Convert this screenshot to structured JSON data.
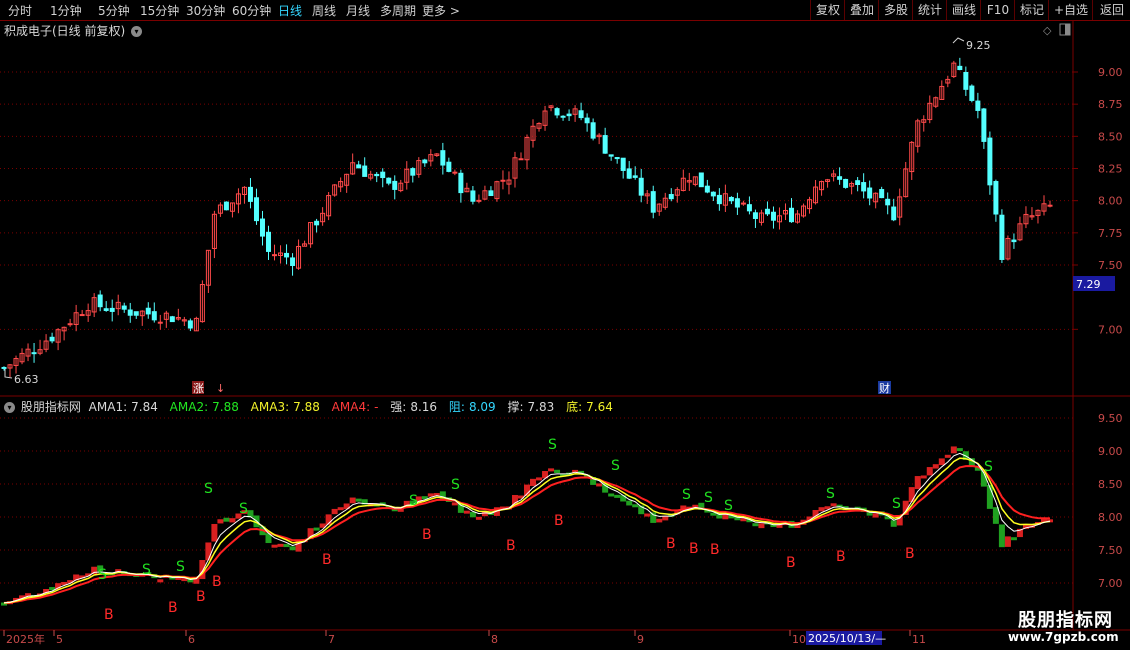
{
  "toolbar": {
    "period_tabs": [
      "分时",
      "1分钟",
      "5分钟",
      "15分钟",
      "30分钟",
      "60分钟",
      "日线",
      "周线",
      "月线",
      "多周期",
      "更多 >"
    ],
    "active_tab": "日线",
    "right_buttons": [
      "复权",
      "叠加",
      "多股",
      "统计",
      "画线",
      "F10",
      "标记",
      "+自选",
      "返回"
    ]
  },
  "chart": {
    "title": "积成电子(日线 前复权)",
    "price_axis": [
      "9.00",
      "8.75",
      "8.50",
      "8.25",
      "8.00",
      "7.75",
      "7.50",
      "7.00"
    ],
    "current_price_tag": "7.29",
    "high_label": "9.25",
    "low_label": "6.63",
    "event_labels": [
      "涨",
      "↓",
      "财"
    ]
  },
  "indicator": {
    "name": "股朋指标网",
    "values": [
      {
        "label": "AMA1:",
        "value": "7.84",
        "color": "#d8d8d8"
      },
      {
        "label": "AMA2:",
        "value": "7.88",
        "color": "#22e822"
      },
      {
        "label": "AMA3:",
        "value": "7.88",
        "color": "#f2f22a"
      },
      {
        "label": "AMA4:",
        "value": "-",
        "color": "#ff3a3a"
      },
      {
        "label": "强:",
        "value": "8.16",
        "color": "#d8d8d8"
      },
      {
        "label": "阻:",
        "value": "8.09",
        "color": "#34d7ff"
      },
      {
        "label": "撑:",
        "value": "7.83",
        "color": "#d8d8d8"
      },
      {
        "label": "底:",
        "value": "7.64",
        "color": "#f2f22a"
      }
    ],
    "axis": [
      "9.50",
      "9.00",
      "8.50",
      "8.00",
      "7.50",
      "7.00"
    ],
    "signal_B": "B",
    "signal_S": "S"
  },
  "time_axis": {
    "labels": [
      "2025年",
      "5",
      "6",
      "7",
      "8",
      "9",
      "10",
      "11"
    ],
    "cursor_date": "2025/10/13/—"
  },
  "watermark": {
    "title": "股朋指标网",
    "url": "www.7gpzb.com"
  },
  "colors": {
    "up": "#ff4a4a",
    "down": "#54ffff",
    "grid": "#7a0000",
    "ama_white": "#ffffff",
    "ama_red": "#ff2020",
    "ama_yellow": "#ffff20",
    "ama_green": "#20e020"
  }
}
